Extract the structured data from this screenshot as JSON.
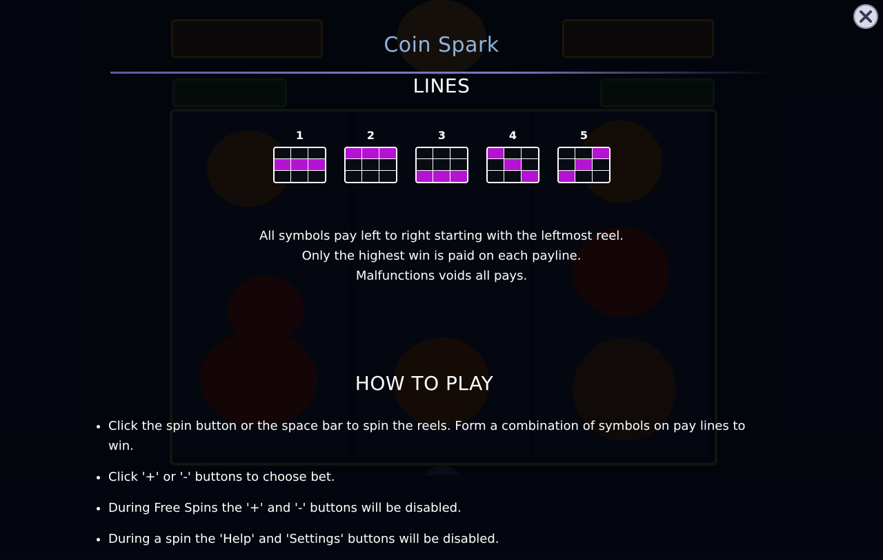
{
  "title": "Coin Spark",
  "close_icon": "close-icon",
  "lines": {
    "heading": "LINES",
    "items": [
      {
        "number": "1",
        "pattern": [
          [
            0,
            0,
            0
          ],
          [
            1,
            1,
            1
          ],
          [
            0,
            0,
            0
          ]
        ]
      },
      {
        "number": "2",
        "pattern": [
          [
            1,
            1,
            1
          ],
          [
            0,
            0,
            0
          ],
          [
            0,
            0,
            0
          ]
        ]
      },
      {
        "number": "3",
        "pattern": [
          [
            0,
            0,
            0
          ],
          [
            0,
            0,
            0
          ],
          [
            1,
            1,
            1
          ]
        ]
      },
      {
        "number": "4",
        "pattern": [
          [
            1,
            0,
            0
          ],
          [
            0,
            1,
            0
          ],
          [
            0,
            0,
            1
          ]
        ]
      },
      {
        "number": "5",
        "pattern": [
          [
            0,
            0,
            1
          ],
          [
            0,
            1,
            0
          ],
          [
            1,
            0,
            0
          ]
        ]
      }
    ],
    "highlight_color": "#b413d2"
  },
  "rules": [
    "All symbols pay left to right starting with the leftmost reel.",
    "Only the highest win is paid on each payline.",
    "Malfunctions voids all pays."
  ],
  "how_to_play": {
    "heading": "HOW TO PLAY",
    "items": [
      "Click the spin button or the space bar  to spin the reels. Form a combination of symbols on pay lines to win.",
      "Click '+' or '-' buttons to choose bet.",
      "During Free Spins the '+' and '-' buttons will be disabled.",
      "During a spin the 'Help' and 'Settings' buttons will be disabled."
    ]
  },
  "colors": {
    "title": "#8fb4e0",
    "background": "#050812"
  }
}
